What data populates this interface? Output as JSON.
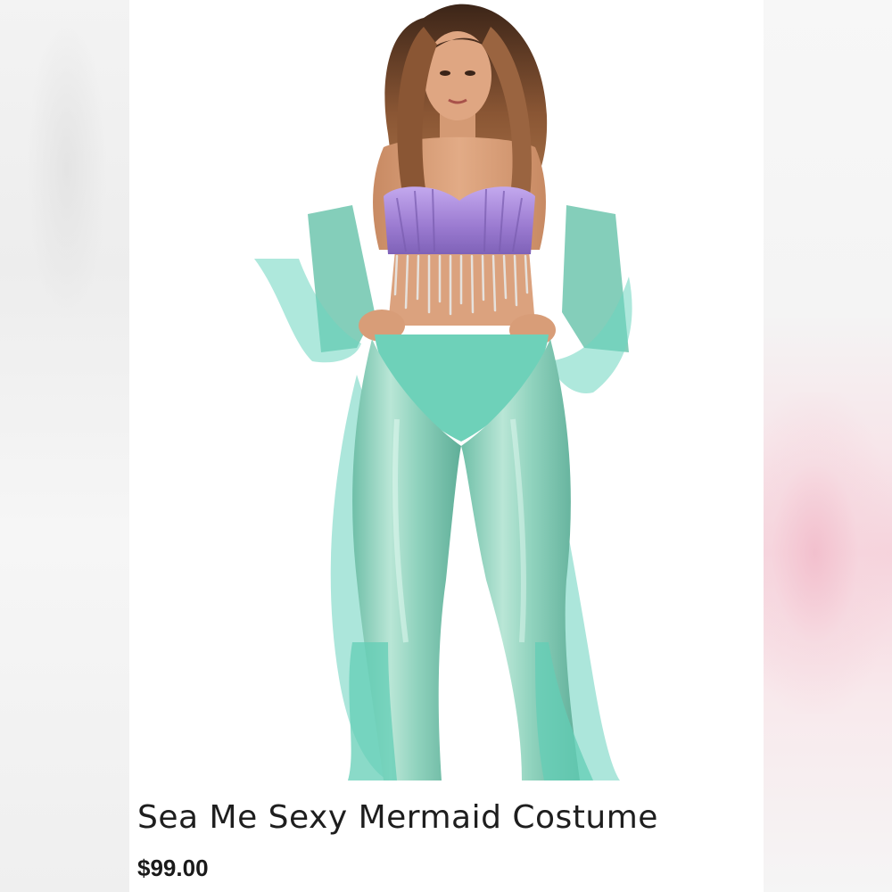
{
  "product": {
    "title": "Sea Me Sexy Mermaid Costume",
    "price": "$99.00",
    "image": {
      "subject": "model-in-mermaid-costume",
      "colors": {
        "top": "#a88ad8",
        "fringe": "#e0dcd8",
        "leggings": "#7fcbb5",
        "mesh": "#6fd4c0",
        "skin": "#d9a07c",
        "hair": "#7a4a2c"
      }
    }
  },
  "backdrop": {
    "left_tint": "#ececec",
    "right_tint": "#f4c9d4"
  }
}
